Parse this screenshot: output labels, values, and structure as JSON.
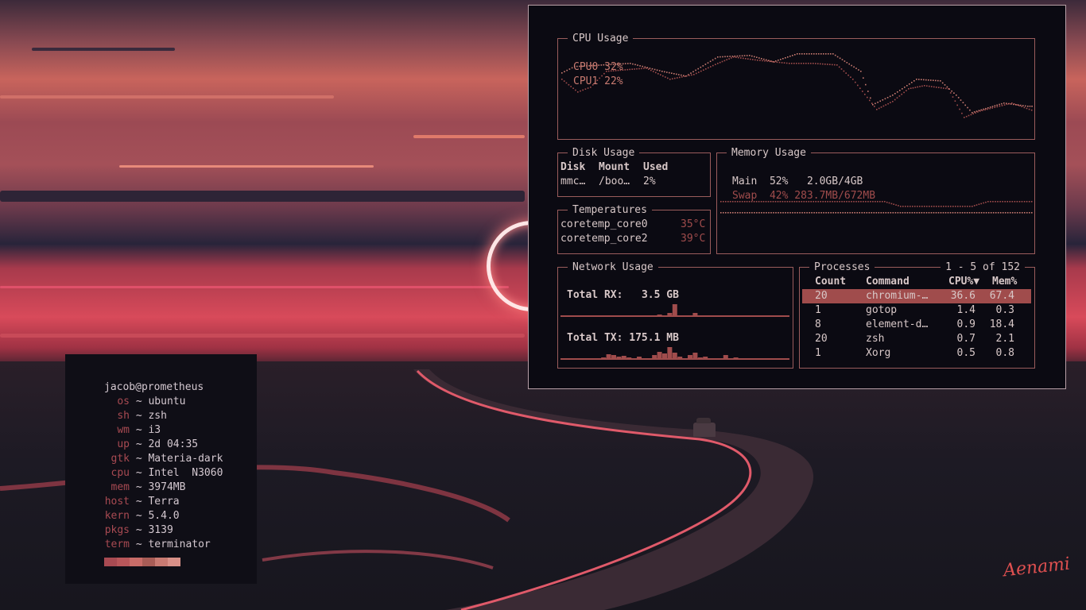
{
  "neofetch": {
    "user_host": "jacob@prometheus",
    "rows": [
      {
        "key": "os",
        "value": "ubuntu"
      },
      {
        "key": "sh",
        "value": "zsh"
      },
      {
        "key": "wm",
        "value": "i3"
      },
      {
        "key": "up",
        "value": "2d 04:35"
      },
      {
        "key": "gtk",
        "value": "Materia-dark"
      },
      {
        "key": "cpu",
        "value": "Intel  N3060"
      },
      {
        "key": "mem",
        "value": "3974MB"
      },
      {
        "key": "host",
        "value": "Terra"
      },
      {
        "key": "kern",
        "value": "5.4.0"
      },
      {
        "key": "pkgs",
        "value": "3139"
      },
      {
        "key": "term",
        "value": "terminator"
      }
    ],
    "separator": "~",
    "palette": [
      "#a84a52",
      "#b8565a",
      "#c86c68",
      "#a85c56",
      "#c87a72",
      "#d89088"
    ]
  },
  "gotop": {
    "cpu": {
      "title": "CPU Usage",
      "cores": [
        {
          "label": "CPU0",
          "value": "32%"
        },
        {
          "label": "CPU1",
          "value": "22%"
        }
      ]
    },
    "disk": {
      "title": "Disk Usage",
      "headers": [
        "Disk",
        "Mount",
        "Used"
      ],
      "rows": [
        [
          "mmc…",
          "/boo…",
          "2%"
        ]
      ]
    },
    "temperatures": {
      "title": "Temperatures",
      "rows": [
        {
          "name": "coretemp_core0",
          "value": "35°C"
        },
        {
          "name": "coretemp_core2",
          "value": "39°C"
        }
      ]
    },
    "memory": {
      "title": "Memory Usage",
      "rows": [
        {
          "label": "Main",
          "percent": "52%",
          "amount": "2.0GB/4GB"
        },
        {
          "label": "Swap",
          "percent": "42%",
          "amount": "283.7MB/672MB"
        }
      ]
    },
    "network": {
      "title": "Network Usage",
      "rx_label": "Total RX:",
      "rx_value": "3.5 GB",
      "tx_label": "Total TX:",
      "tx_value": "175.1 MB",
      "rx_bars": [
        0,
        0,
        0,
        0,
        0,
        0,
        0,
        0,
        0,
        0,
        0,
        0,
        0,
        0,
        0,
        0,
        0,
        0,
        0,
        1,
        0,
        3,
        14,
        0,
        0,
        0,
        3,
        0,
        0,
        0,
        0,
        0,
        0,
        0,
        0,
        0,
        0,
        0,
        0,
        0,
        0,
        0,
        0,
        0,
        0
      ],
      "tx_bars": [
        0,
        0,
        0,
        0,
        0,
        0,
        0,
        0,
        1,
        5,
        4,
        2,
        3,
        1,
        0,
        2,
        0,
        0,
        4,
        8,
        6,
        14,
        7,
        2,
        0,
        4,
        7,
        1,
        2,
        0,
        0,
        0,
        4,
        0,
        1,
        0,
        0,
        0,
        0,
        0,
        0,
        0,
        0,
        0,
        0
      ]
    },
    "processes": {
      "title": "Processes",
      "range": "1 - 5 of 152",
      "headers": [
        "Count",
        "Command",
        "CPU%▼",
        "Mem%"
      ],
      "rows": [
        [
          "20",
          "chromium-…",
          "36.6",
          "67.4"
        ],
        [
          "1",
          "gotop",
          "1.4",
          "0.3"
        ],
        [
          "8",
          "element-d…",
          "0.9",
          "18.4"
        ],
        [
          "20",
          "zsh",
          "0.7",
          "2.1"
        ],
        [
          "1",
          "Xorg",
          "0.5",
          "0.8"
        ]
      ]
    },
    "colors": {
      "border": "#9a5c5c",
      "text": "#d8c8c8",
      "accent": "#c77a70",
      "selected_row": "#a04c4c"
    }
  },
  "wallpaper": {
    "signature": "Aenami"
  }
}
